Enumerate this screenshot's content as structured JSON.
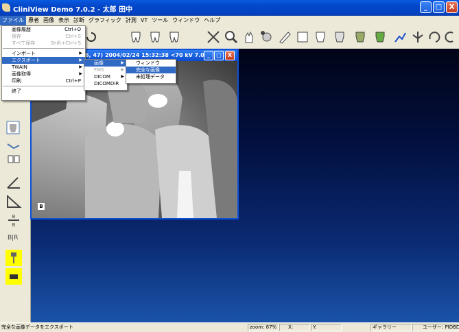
{
  "window": {
    "title": "CliniView Demo 7.0.2 - 太郎 田中",
    "minimize": "_",
    "maximize": "□",
    "close": "X"
  },
  "menubar": [
    "ファイル",
    "患者",
    "画像",
    "表示",
    "診断",
    "グラフィック",
    "計測",
    "VT",
    "ツール",
    "ウィンドウ",
    "ヘルプ"
  ],
  "file_menu": {
    "items": [
      {
        "label": "画像履歴",
        "shortcut": "Ctrl+O",
        "state": "normal"
      },
      {
        "label": "保存",
        "shortcut": "Ctrl+S",
        "state": "disabled"
      },
      {
        "label": "すべて保存",
        "shortcut": "Shift+Ctrl+S",
        "state": "disabled"
      },
      {
        "label": "インポート",
        "shortcut": "",
        "state": "submenu"
      },
      {
        "label": "エクスポート",
        "shortcut": "",
        "state": "highlighted"
      },
      {
        "label": "TWAIN",
        "shortcut": "",
        "state": "submenu"
      },
      {
        "label": "画像取得",
        "shortcut": "",
        "state": "submenu"
      },
      {
        "label": "印刷",
        "shortcut": "Ctrl+P",
        "state": "normal"
      },
      {
        "label": "終了",
        "shortcut": "",
        "state": "normal"
      }
    ]
  },
  "export_submenu": [
    {
      "label": "画像",
      "state": "highlighted"
    },
    {
      "label": "FMS",
      "state": "disabled"
    },
    {
      "label": "DICOM",
      "state": "submenu"
    },
    {
      "label": "DICOMDIR",
      "state": "normal"
    }
  ],
  "image_submenu": [
    {
      "label": "ウィンドウ",
      "state": "normal"
    },
    {
      "label": "完全な画像",
      "state": "highlighted"
    },
    {
      "label": "未処理データ",
      "state": "normal"
    }
  ],
  "image_window": {
    "title": "6, 47)  2004/02/24 15:32:38 <70 kV 7.0 ...",
    "corner_marker": "B"
  },
  "statusbar": {
    "message": "完全な画像データをエクスポート",
    "zoom": "zoom: 87%",
    "coord_x": "X:",
    "coord_y": "Y:",
    "gallery": "ギャラリー",
    "user": "ユーザー: PIDBDefault"
  },
  "colors": {
    "accent": "#316ac5",
    "titlebar": "#0a5ae0",
    "workspace": "#021040"
  }
}
